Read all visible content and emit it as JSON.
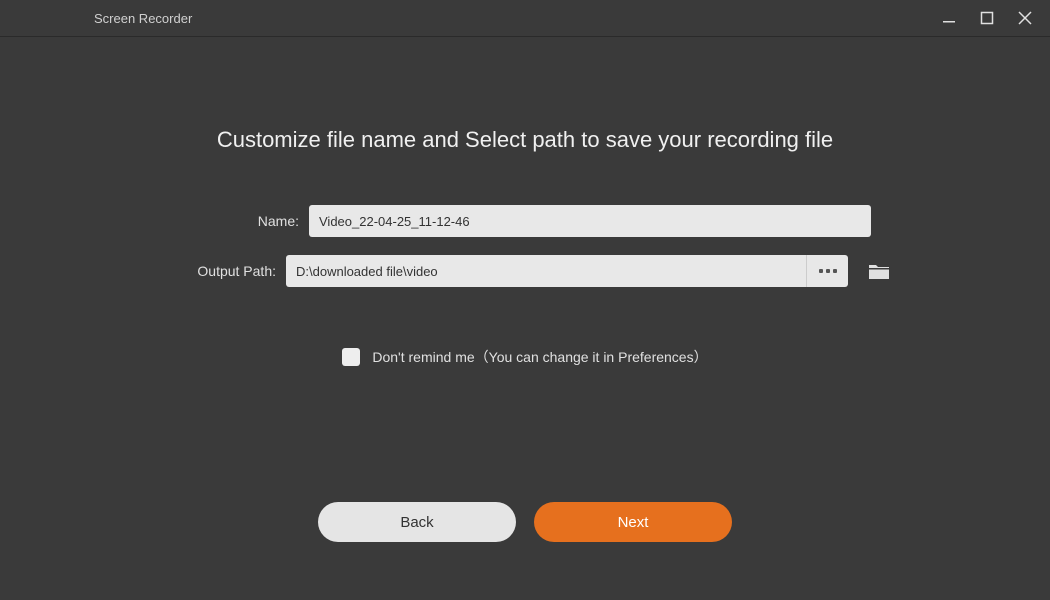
{
  "window": {
    "title": "Screen Recorder"
  },
  "heading": "Customize file name and Select path to save your recording file",
  "form": {
    "name_label": "Name:",
    "name_value": "Video_22-04-25_11-12-46",
    "path_label": "Output Path:",
    "path_value": "D:\\downloaded file\\video"
  },
  "remind": {
    "label": "Don't remind me（You can change it in Preferences）"
  },
  "buttons": {
    "back": "Back",
    "next": "Next"
  }
}
